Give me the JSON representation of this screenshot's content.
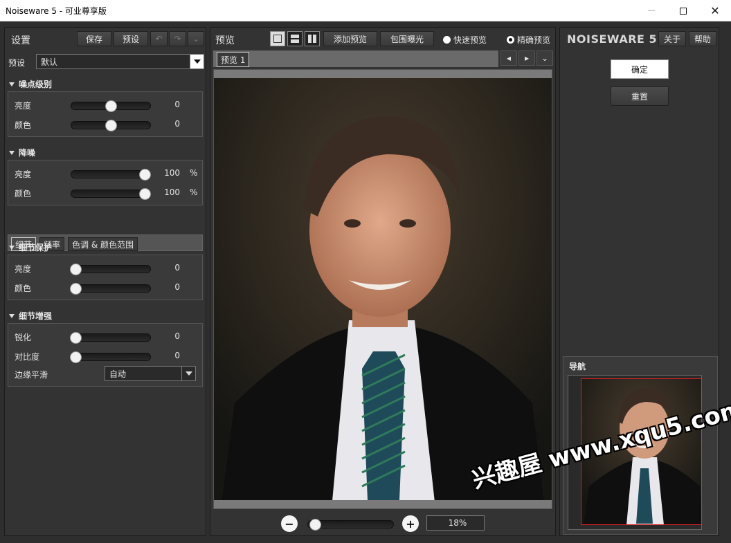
{
  "window": {
    "title": "Noiseware 5 - 可业尊享版"
  },
  "left": {
    "header": "设置",
    "save_label": "保存",
    "preset_btn_label": "预设",
    "preset_label": "预设",
    "preset_value": "默认",
    "noise_level": {
      "title": "噪点级别",
      "rows": [
        {
          "label": "亮度",
          "value": "0",
          "fraction": 0.5
        },
        {
          "label": "颜色",
          "value": "0",
          "fraction": 0.5
        }
      ]
    },
    "noise_reduction": {
      "title": "降噪",
      "rows": [
        {
          "label": "亮度",
          "value": "100",
          "unit": "%",
          "fraction": 0.93
        },
        {
          "label": "颜色",
          "value": "100",
          "unit": "%",
          "fraction": 0.93
        }
      ]
    },
    "tabs": [
      "细节",
      "频率",
      "色调 & 颜色范围"
    ],
    "detail_protection": {
      "title": "细节保护",
      "rows": [
        {
          "label": "亮度",
          "value": "0",
          "fraction": 0.05
        },
        {
          "label": "颜色",
          "value": "0",
          "fraction": 0.05
        }
      ]
    },
    "detail_enhance": {
      "title": "细节增强",
      "rows": [
        {
          "label": "锐化",
          "value": "0",
          "fraction": 0.05
        },
        {
          "label": "对比度",
          "value": "0",
          "fraction": 0.05
        }
      ],
      "edge_label": "边缘平滑",
      "edge_value": "自动"
    }
  },
  "mid": {
    "header": "预览",
    "add_preview": "添加预览",
    "gamut_exposure": "包围曝光",
    "fast_preview": "快速预览",
    "accurate_preview": "精确预览",
    "tab": "预览 1",
    "zoom": "18%",
    "zoom_fraction": 0.08
  },
  "right": {
    "brand": "NOISEWARE 5",
    "about": "关于",
    "help": "帮助",
    "ok": "确定",
    "reset": "重置",
    "nav_title": "导航"
  },
  "watermark": "兴趣屋 www.xqu5.com"
}
